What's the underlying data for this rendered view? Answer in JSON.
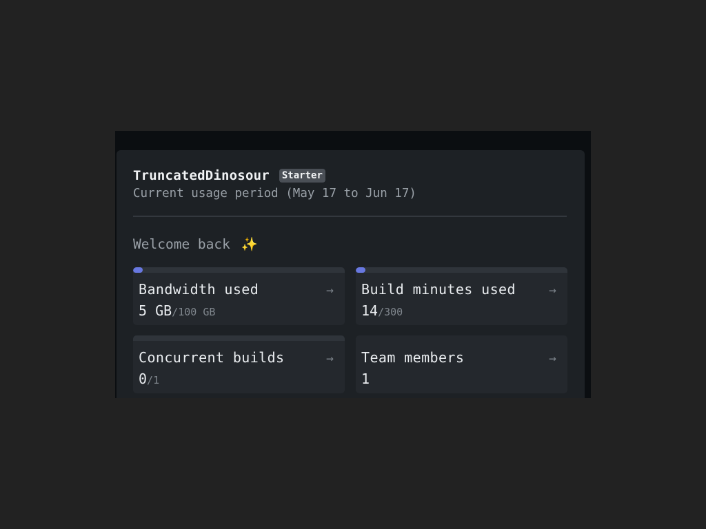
{
  "header": {
    "site_name": "TruncatedDinosour",
    "plan_badge": "Starter",
    "period": "Current usage period (May 17 to Jun 17)"
  },
  "welcome": {
    "text": "Welcome back",
    "emoji": "✨"
  },
  "tiles": [
    {
      "label": "Bandwidth used",
      "value": "5 GB",
      "limit": "/100 GB",
      "usage_fraction": 0.05,
      "arrow": "→"
    },
    {
      "label": "Build minutes used",
      "value": "14",
      "limit": "/300",
      "usage_fraction": 0.047,
      "arrow": "→"
    },
    {
      "label": "Concurrent builds",
      "value": "0",
      "limit": "/1",
      "usage_fraction": 0,
      "arrow": "→"
    },
    {
      "label": "Team members",
      "value": "1",
      "arrow": "→"
    }
  ],
  "colors": {
    "accent": "#6878e0",
    "card": "#1d2125",
    "tile": "#24282d"
  }
}
